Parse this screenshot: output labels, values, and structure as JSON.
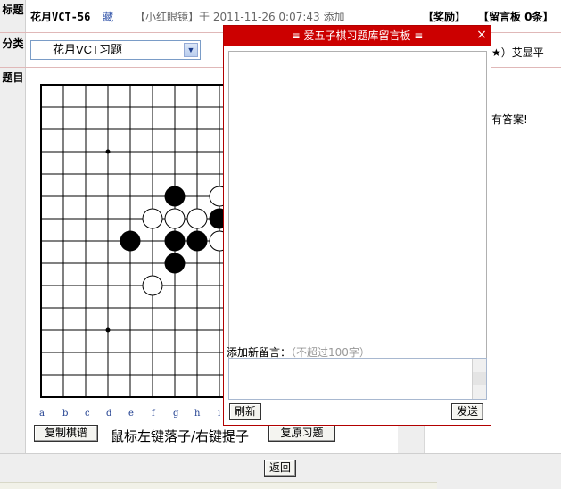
{
  "labels": {
    "title": "标题",
    "category": "分类",
    "problem": "题目"
  },
  "header": {
    "title": "花月VCT-56",
    "favorite": "藏",
    "author_info": "【小红眼镜】于 2011-11-26 0:07:43 添加",
    "reward": "【奖励】",
    "message_board": "【留言板 0条】"
  },
  "category_select": {
    "selected": "花月VCT习题"
  },
  "stars_text": "★）艾显平",
  "answer_text": "有答案!",
  "board": {
    "size": 15,
    "column_labels": [
      "a",
      "b",
      "c",
      "d",
      "e",
      "f",
      "g",
      "h",
      "i"
    ],
    "star_points": [
      [
        3,
        3
      ],
      [
        7,
        7
      ],
      [
        11,
        3
      ],
      [
        3,
        11
      ],
      [
        11,
        11
      ]
    ],
    "black": [
      [
        6,
        5
      ],
      [
        8,
        6
      ],
      [
        4,
        7
      ],
      [
        6,
        7
      ],
      [
        7,
        7
      ],
      [
        6,
        8
      ]
    ],
    "white": [
      [
        8,
        5
      ],
      [
        5,
        6
      ],
      [
        6,
        6
      ],
      [
        7,
        6
      ],
      [
        8,
        7
      ],
      [
        5,
        9
      ]
    ],
    "colors": {
      "line": "#000000",
      "black": "#000000",
      "white": "#ffffff"
    }
  },
  "actions": {
    "copy_record": "复制棋谱",
    "mouse_hint": "鼠标左键落子/右键提子",
    "restore": "复原习题",
    "back": "返回"
  },
  "popup": {
    "title": "≡ 爱五子棋习题库留言板 ≡",
    "close": "×",
    "add_label": "添加新留言：",
    "add_hint": "（不超过100字）",
    "refresh": "刷新",
    "send": "发送"
  },
  "theme": {
    "popup_header": "#cc0000",
    "link": "#3355aa"
  }
}
